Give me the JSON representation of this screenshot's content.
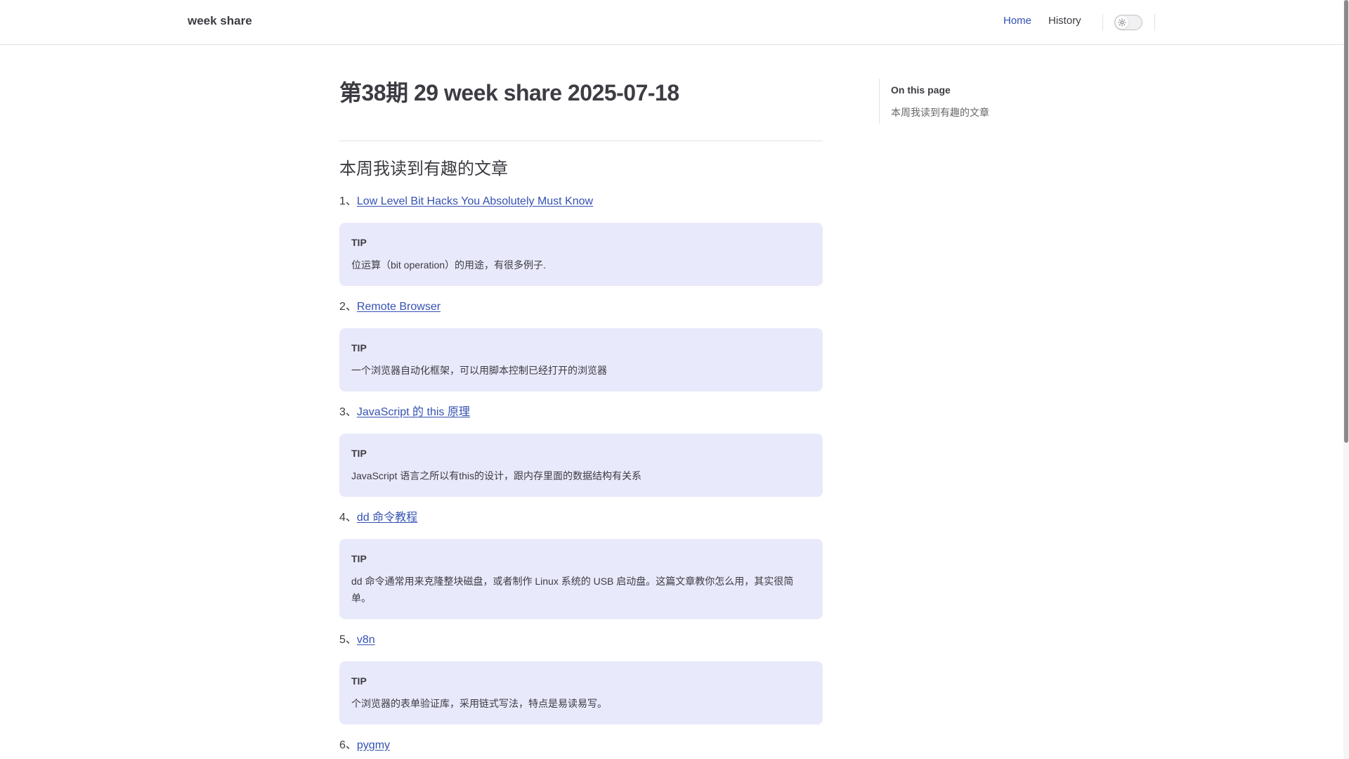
{
  "nav": {
    "site_title": "week share",
    "links": [
      {
        "label": "Home",
        "active": true
      },
      {
        "label": "History",
        "active": false
      }
    ],
    "theme_icon": "sun-icon"
  },
  "page": {
    "title": "第38期 29 week share 2025-07-18",
    "section_heading": "本周我读到有趣的文章"
  },
  "articles": [
    {
      "prefix": "1、",
      "link": "Low Level Bit Hacks You Absolutely Must Know",
      "tip_title": "TIP",
      "tip_text": "位运算（bit operation）的用途，有很多例子."
    },
    {
      "prefix": "2、",
      "link": "Remote Browser",
      "tip_title": "TIP",
      "tip_text": "一个浏览器自动化框架，可以用脚本控制已经打开的浏览器"
    },
    {
      "prefix": "3、",
      "link": "JavaScript 的 this 原理",
      "tip_title": "TIP",
      "tip_text": "JavaScript 语言之所以有this的设计，跟内存里面的数据结构有关系"
    },
    {
      "prefix": "4、",
      "link": "dd 命令教程",
      "tip_title": "TIP",
      "tip_text": "dd 命令通常用来克隆整块磁盘，或者制作 Linux 系统的 USB 启动盘。这篇文章教你怎么用，其实很简单。"
    },
    {
      "prefix": "5、",
      "link": "v8n",
      "tip_title": "TIP",
      "tip_text": "个浏览器的表单验证库，采用链式写法，特点是易读易写。"
    },
    {
      "prefix": "6、",
      "link": "pygmy"
    }
  ],
  "outline": {
    "title": "On this page",
    "items": [
      "本周我读到有趣的文章"
    ]
  },
  "colors": {
    "brand": "#3451b2",
    "tip_background": "#e9e9fc",
    "text": "#3c3c43"
  }
}
